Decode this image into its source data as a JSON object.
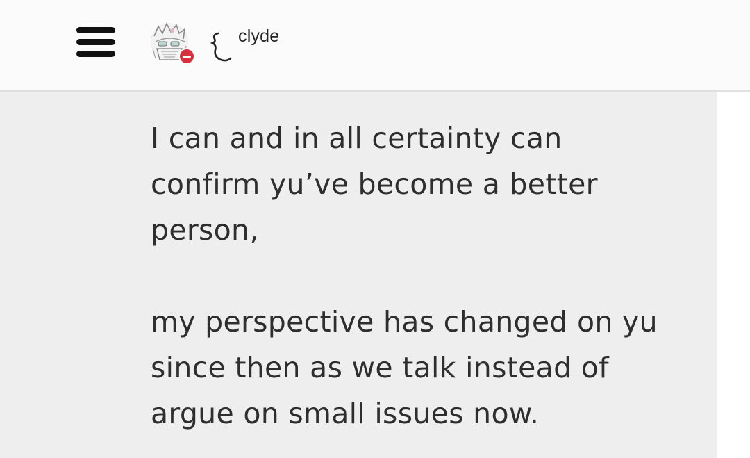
{
  "header": {
    "menu_icon": "hamburger-menu-icon",
    "avatar_icon": "profile-avatar",
    "status": "do-not-disturb",
    "status_color": "#d6313f",
    "name_decoration": "curly-bracket-glyph",
    "username": "clyde"
  },
  "message": {
    "paragraph1": [
      "I can and in all certainty can",
      "confirm yu’ve become a better",
      "person,"
    ],
    "paragraph2": [
      "my perspective has changed on yu",
      "since then as we talk instead of",
      "argue on small issues now."
    ]
  },
  "colors": {
    "header_bg": "#fbfbfb",
    "panel_bg": "#eeeeee",
    "text": "#2e2e2e"
  }
}
